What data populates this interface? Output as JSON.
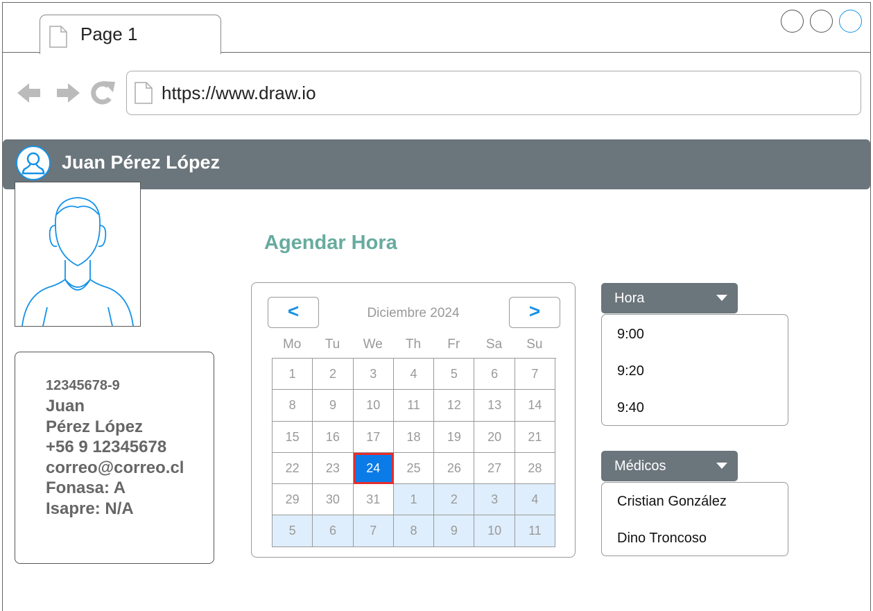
{
  "browser": {
    "tab_label": "Page 1",
    "url": "https://www.draw.io"
  },
  "user": {
    "name": "Juan Pérez López"
  },
  "patient": {
    "rut": "12345678-9",
    "first_name": "Juan",
    "last_name": "Pérez López",
    "phone": "+56 9 12345678",
    "email": "correo@correo.cl",
    "fonasa": "Fonasa: A",
    "isapre": "Isapre: N/A"
  },
  "title": "Agendar Hora",
  "calendar": {
    "prev_label": "<",
    "next_label": ">",
    "month_label": "Diciembre 2024",
    "weekdays": [
      "Mo",
      "Tu",
      "We",
      "Th",
      "Fr",
      "Sa",
      "Su"
    ],
    "selected_day": "24",
    "weeks": [
      [
        "1",
        "2",
        "3",
        "4",
        "5",
        "6",
        "7"
      ],
      [
        "8",
        "9",
        "10",
        "11",
        "12",
        "13",
        "14"
      ],
      [
        "15",
        "16",
        "17",
        "18",
        "19",
        "20",
        "21"
      ],
      [
        "22",
        "23",
        "24",
        "25",
        "26",
        "27",
        "28"
      ],
      [
        "29",
        "30",
        "31",
        "1",
        "2",
        "3",
        "4"
      ],
      [
        "5",
        "6",
        "7",
        "8",
        "9",
        "10",
        "11"
      ]
    ]
  },
  "hora": {
    "label": "Hora",
    "options": [
      "9:00",
      "9:20",
      "9:40"
    ]
  },
  "medicos": {
    "label": "Médicos",
    "options": [
      "Cristian González",
      "Dino Troncoso"
    ]
  },
  "colors": {
    "accent": "#1592e8",
    "header_bg": "#6b757c",
    "title_green": "#67ab9f",
    "selected_day_bg": "#0b7be8",
    "selected_day_border": "#e52d2d",
    "next_month_bg": "#dfeefc"
  }
}
